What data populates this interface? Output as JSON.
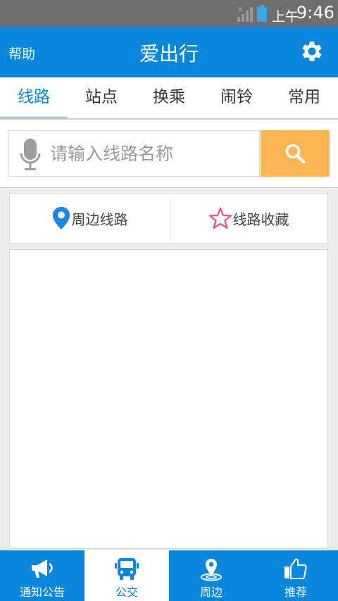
{
  "status_bar": {
    "ampm": "上午",
    "time": "9:46",
    "icons": [
      "signal-icon",
      "battery-icon"
    ]
  },
  "header": {
    "help_label": "帮助",
    "title": "爱出行",
    "settings_icon": "gear-icon"
  },
  "tabs": [
    {
      "label": "线路",
      "active": true
    },
    {
      "label": "站点",
      "active": false
    },
    {
      "label": "换乘",
      "active": false
    },
    {
      "label": "闹铃",
      "active": false
    },
    {
      "label": "常用",
      "active": false
    }
  ],
  "search": {
    "placeholder": "请输入线路名称",
    "value": "",
    "mic_icon": "microphone-icon",
    "button_icon": "magnifier-icon"
  },
  "shortcuts": {
    "nearby_routes": "周边线路",
    "favorite_routes": "线路收藏"
  },
  "bottom_nav": [
    {
      "label": "通知公告",
      "icon": "megaphone-icon",
      "active": false
    },
    {
      "label": "公交",
      "icon": "bus-icon",
      "active": true
    },
    {
      "label": "周边",
      "icon": "location-pin-icon",
      "active": false
    },
    {
      "label": "推荐",
      "icon": "thumbs-up-icon",
      "active": false
    }
  ],
  "colors": {
    "primary": "#0a87dc",
    "search_button": "#fbb555",
    "favorite_star": "#e75480",
    "status_bar": "#6e6e6e"
  }
}
